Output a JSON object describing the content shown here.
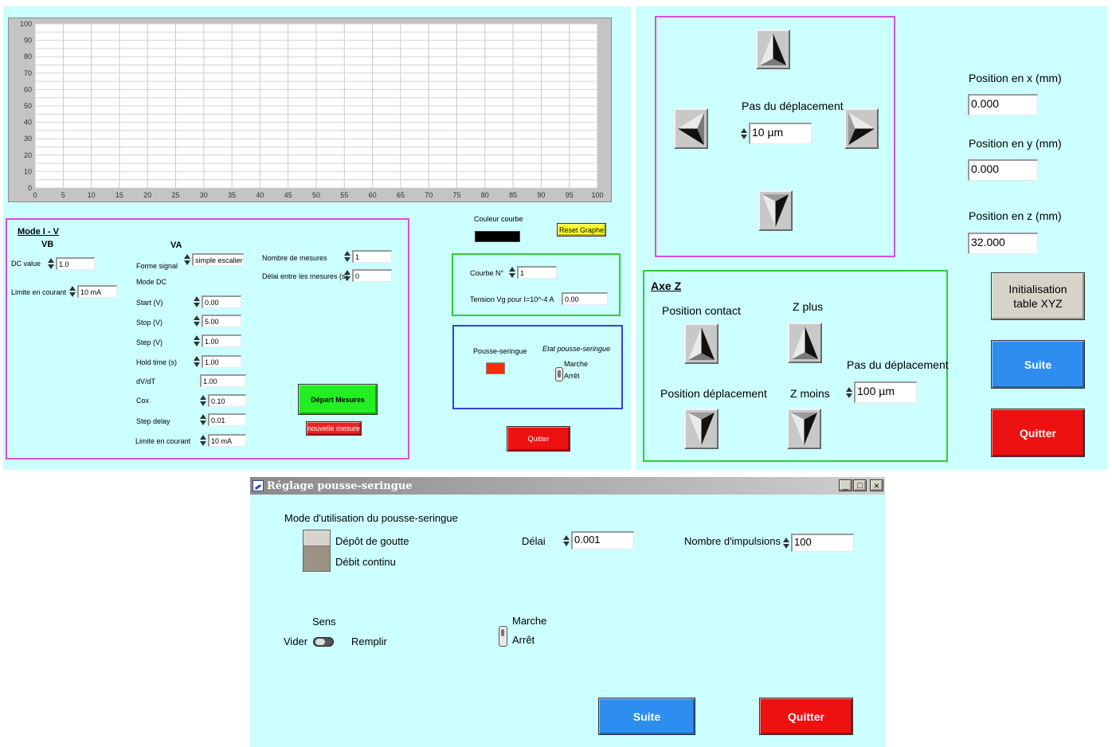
{
  "chart_data": {
    "type": "line",
    "series": [],
    "xlim": [
      0,
      100
    ],
    "ylim": [
      0,
      100
    ],
    "x_ticks": [
      "0",
      "5",
      "10",
      "15",
      "20",
      "25",
      "30",
      "35",
      "40",
      "45",
      "50",
      "55",
      "60",
      "65",
      "70",
      "75",
      "80",
      "85",
      "90",
      "95",
      "100"
    ],
    "y_ticks": [
      "100",
      "90",
      "80",
      "70",
      "60",
      "50",
      "40",
      "30",
      "20",
      "10",
      "0"
    ],
    "grid": true
  },
  "iv": {
    "title": "Mode I - V",
    "vb_label": "VB",
    "va_label": "VA",
    "dc_value_label": "DC value",
    "dc_value": "1.0",
    "limit_label": "Limite en  courant",
    "limit_value": "10 mA",
    "signal_label": "Forme signal",
    "signal_value": "simple escalier",
    "mode_dc_label": "Mode DC",
    "start_label": "Start (V)",
    "start_value": "0.00",
    "stop_label": "Stop (V)",
    "stop_value": "5.00",
    "step_label": "Step (V)",
    "step_value": "1.00",
    "hold_label": "Hold time (s)",
    "hold_value": "1.00",
    "dvdt_label": "dV/dT",
    "dvdt_value": "1.00",
    "cox_label": "Cox",
    "cox_value": "0.10",
    "stepdelay_label": "Step delay",
    "stepdelay_value": "0.01",
    "limit2_label": "Limite en courant",
    "limit2_value": "10 mA",
    "nb_label": "Nombre de mesures",
    "nb_value": "1",
    "delay_label": "Délai entre les mesures (s)",
    "delay_value": "0",
    "start_button": "Départ Mesures",
    "new_button": "nouvelle mesure"
  },
  "curve": {
    "color_label": "Couleur courbe",
    "color": "#000000",
    "reset_button": "Reset  Graphe",
    "curve_label": "Courbe N°",
    "curve_value": "1",
    "tension_label": "Tension Vg pour I=10^-4  A",
    "tension_value": "0.00"
  },
  "pousse": {
    "label": "Pousse-seringue",
    "state_label": "Etat pousse-seringue",
    "marche": "Marche",
    "arret": "Arrêt",
    "led_color": "#ff2a00"
  },
  "left_quit": "Quitter",
  "xyz": {
    "pas_label": "Pas du déplacement",
    "pas_value": "10 µm",
    "pos_x_label": "Position en x (mm)",
    "pos_x": "0.000",
    "pos_y_label": "Position en y (mm)",
    "pos_y": "0.000",
    "pos_z_label": "Position en z (mm)",
    "pos_z": "32.000",
    "axe_z_title": "Axe Z",
    "contact_label": "Position contact",
    "zplus_label": "Z plus",
    "deplacement_label": "Position déplacement",
    "zmoins_label": "Z moins",
    "pas_z_label": "Pas du déplacement",
    "pas_z_value": "100 µm",
    "init_button": "Initialisation table XYZ",
    "suite_button": "Suite",
    "quit_button": "Quitter"
  },
  "dialog": {
    "title": "Réglage pousse-seringue",
    "mode_label": "Mode d'utilisation du pousse-seringue",
    "option1": "Dépôt de goutte",
    "option2": "Débit continu",
    "delai_label": "Délai",
    "delai_value": "0.001",
    "impulsions_label": "Nombre d'impulsions",
    "impulsions_value": "100",
    "sens_label": "Sens",
    "vider": "Vider",
    "remplir": "Remplir",
    "marche": "Marche",
    "arret": "Arrêt",
    "suite_button": "Suite",
    "quit_button": "Quitter",
    "min_glyph": "_",
    "max_glyph": "□",
    "close_glyph": "×"
  },
  "colors": {
    "panel_bg": "#ccffff",
    "magenta": "#d94fd6",
    "green": "#33cc33",
    "blue": "#3344cc",
    "quit_red": "#ee1111",
    "suite_blue": "#2e8ef0",
    "start_green": "#22ee22"
  }
}
